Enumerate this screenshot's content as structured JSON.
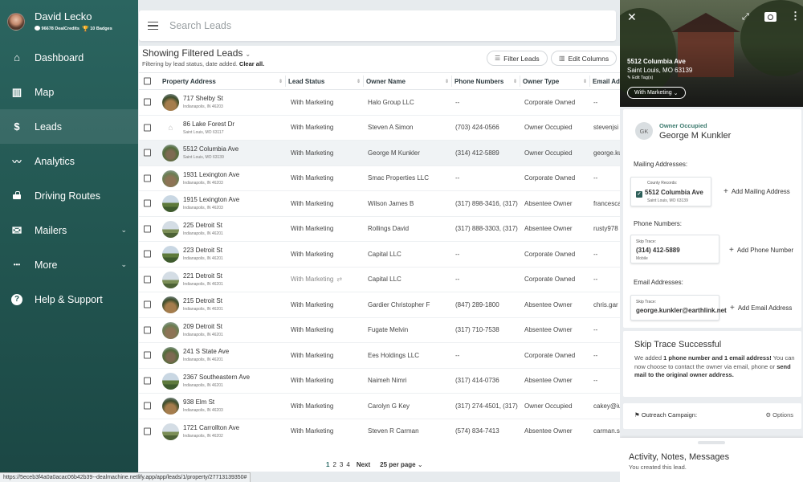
{
  "profile": {
    "name": "David Lecko",
    "credits": "96678 DealCredits",
    "badges": "10 Badges"
  },
  "nav": [
    {
      "label": "Dashboard",
      "icon": "home-icon",
      "glyph": "⌂"
    },
    {
      "label": "Map",
      "icon": "map-icon",
      "glyph": "▥"
    },
    {
      "label": "Leads",
      "icon": "dollar-icon",
      "glyph": "$"
    },
    {
      "label": "Analytics",
      "icon": "trend-icon",
      "glyph": "〰"
    },
    {
      "label": "Driving Routes",
      "icon": "car-icon",
      "glyph": "🚗"
    },
    {
      "label": "Mailers",
      "icon": "mail-icon",
      "glyph": "✉"
    },
    {
      "label": "More",
      "icon": "more-icon",
      "glyph": "•••"
    },
    {
      "label": "Help & Support",
      "icon": "help-icon",
      "glyph": "?"
    }
  ],
  "status_url": "https://5eceb3f4a0a0acac06b42b39--dealmachine.netlify.app/app/leads/1/property/27713139350#",
  "search": {
    "placeholder": "Search Leads"
  },
  "leads": {
    "title": "Showing Filtered Leads",
    "subtitle_prefix": "Filtering by lead status, date added.",
    "clear_all": "Clear all.",
    "filter_btn": "Filter Leads",
    "columns_btn": "Edit Columns"
  },
  "columns": [
    "Property Address",
    "Lead Status",
    "Owner Name",
    "Phone Numbers",
    "Owner Type",
    "Email Ad"
  ],
  "rows": [
    {
      "a1": "717 Shelby St",
      "a2": "Indianapolis, IN 46203",
      "status": "With Marketing",
      "owner": "Halo Group LLC",
      "phone": "--",
      "type": "Corporate Owned",
      "email": "--",
      "thumb": "t1"
    },
    {
      "a1": "86 Lake Forest Dr",
      "a2": "Saint Louis, MO 63117",
      "status": "With Marketing",
      "owner": "Steven A Simon",
      "phone": "(703) 424-0566",
      "type": "Owner Occupied",
      "email": "stevenjsi",
      "thumb": "home"
    },
    {
      "a1": "5512 Columbia Ave",
      "a2": "Saint Louis, MO 63139",
      "status": "With Marketing",
      "owner": "George M Kunkler",
      "phone": "(314) 412-5889",
      "type": "Owner Occupied",
      "email": "george.ku",
      "thumb": "t2"
    },
    {
      "a1": "1931 Lexington Ave",
      "a2": "Indianapolis, IN 46203",
      "status": "With Marketing",
      "owner": "Smac Properties LLC",
      "phone": "--",
      "type": "Corporate Owned",
      "email": "--",
      "thumb": "t4"
    },
    {
      "a1": "1915 Lexington Ave",
      "a2": "Indianapolis, IN 46203",
      "status": "With Marketing",
      "owner": "Wilson James B",
      "phone": "(317) 898-3416, (317)",
      "type": "Absentee Owner",
      "email": "francesca",
      "thumb": "t3"
    },
    {
      "a1": "225 Detroit St",
      "a2": "Indianapolis, IN 46201",
      "status": "With Marketing",
      "owner": "Rollings David",
      "phone": "(317) 888-3303, (317)",
      "type": "Absentee Owner",
      "email": "rusty978",
      "thumb": "t5"
    },
    {
      "a1": "223 Detroit St",
      "a2": "Indianapolis, IN 46201",
      "status": "With Marketing",
      "owner": "Capital LLC",
      "phone": "--",
      "type": "Corporate Owned",
      "email": "--",
      "thumb": "t3"
    },
    {
      "a1": "221 Detroit St",
      "a2": "Indianapolis, IN 46201",
      "status": "With Marketing",
      "owner": "Capital LLC",
      "phone": "--",
      "type": "Corporate Owned",
      "email": "--",
      "thumb": "t5",
      "sync": true
    },
    {
      "a1": "215 Detroit St",
      "a2": "Indianapolis, IN 46201",
      "status": "With Marketing",
      "owner": "Gardier Christopher F",
      "phone": "(847) 289-1800",
      "type": "Absentee Owner",
      "email": "chris.gar",
      "thumb": "t1"
    },
    {
      "a1": "209 Detroit St",
      "a2": "Indianapolis, IN 46201",
      "status": "With Marketing",
      "owner": "Fugate Melvin",
      "phone": "(317) 710-7538",
      "type": "Absentee Owner",
      "email": "--",
      "thumb": "t4"
    },
    {
      "a1": "241 S State Ave",
      "a2": "Indianapolis, IN 46201",
      "status": "With Marketing",
      "owner": "Ees Holdings LLC",
      "phone": "--",
      "type": "Corporate Owned",
      "email": "--",
      "thumb": "t2"
    },
    {
      "a1": "2367 Southeastern Ave",
      "a2": "Indianapolis, IN 46201",
      "status": "With Marketing",
      "owner": "Naimeh Nimri",
      "phone": "(317) 414-0736",
      "type": "Absentee Owner",
      "email": "--",
      "thumb": "t3"
    },
    {
      "a1": "938 Elm St",
      "a2": "Indianapolis, IN 46203",
      "status": "With Marketing",
      "owner": "Carolyn G Key",
      "phone": "(317) 274-4501, (317)",
      "type": "Owner Occupied",
      "email": "cakey@iu",
      "thumb": "t1"
    },
    {
      "a1": "1721 Carrollton Ave",
      "a2": "Indianapolis, IN 46202",
      "status": "With Marketing",
      "owner": "Steven R Carman",
      "phone": "(574) 834-7413",
      "type": "Absentee Owner",
      "email": "carman.s",
      "thumb": "t5"
    }
  ],
  "pager": {
    "pages": [
      "1",
      "2",
      "3",
      "4"
    ],
    "next": "Next",
    "per_page": "25 per page"
  },
  "panel": {
    "address1": "5512 Columbia Ave",
    "address2": "Saint Louis, MO 63139",
    "edit_tags": "Edit Tag(s)",
    "status_btn": "With Marketing",
    "owner_initials": "GK",
    "owner_type": "Owner Occupied",
    "owner_name": "George M Kunkler",
    "mailing_label": "Mailing Addresses:",
    "mailing_source": "County Records:",
    "mailing_addr1": "5512 Columbia Ave",
    "mailing_addr2": "Saint Louis, MO 63139",
    "add_mailing": "Add Mailing Address",
    "phone_label": "Phone Numbers:",
    "phone_source": "Skip Trace:",
    "phone_value": "(314) 412-5889",
    "phone_type": "Mobile",
    "add_phone": "Add Phone Number",
    "email_label": "Email Addresses:",
    "email_source": "Skip Trace:",
    "email_value": "george.kunkler@earthlink.net",
    "add_email": "Add Email Address",
    "skip_title": "Skip Trace Successful",
    "skip_pre": "We added ",
    "skip_bold1": "1 phone number and 1 email address!",
    "skip_mid": " You can now choose to contact the owner via email, phone or ",
    "skip_bold2": "send mail to the original owner address.",
    "outreach": "Outreach Campaign:",
    "options": "Options",
    "activity_title": "Activity, Notes, Messages",
    "activity_sub": "You created this lead."
  },
  "colors": {
    "sidebar": "#235752",
    "accent": "#2a6b66"
  }
}
